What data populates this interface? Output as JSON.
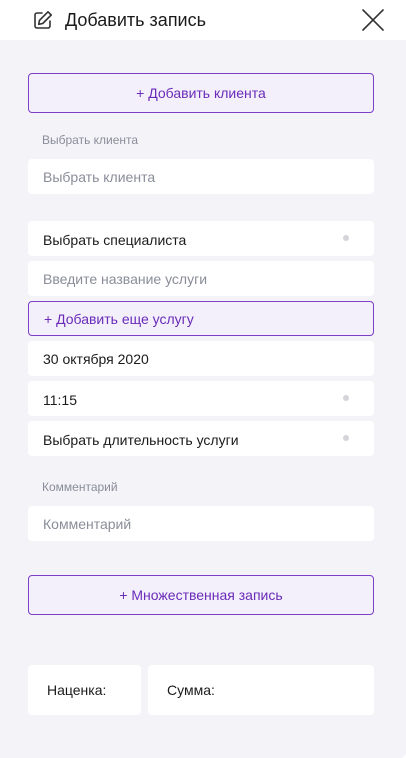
{
  "header": {
    "title": "Добавить запись"
  },
  "form": {
    "add_client_button": "+ Добавить клиента",
    "client_label": "Выбрать клиента",
    "client_placeholder": "Выбрать клиента",
    "specialist_value": "Выбрать специалиста",
    "service_placeholder": "Введите название услуги",
    "add_service_button": "+ Добавить еще услугу",
    "date_value": "30 октября 2020",
    "time_value": "11:15",
    "duration_value": "Выбрать длительность услуги",
    "comment_label": "Комментарий",
    "comment_placeholder": "Комментарий",
    "multiple_button": "+ Множественная запись"
  },
  "footer": {
    "markup_label": "Наценка:",
    "sum_label": "Сумма:"
  },
  "colors": {
    "accent": "#7b3fc8",
    "panel_bg": "#f3f3f8"
  },
  "icons": {
    "edit": "edit-icon",
    "close": "close-icon"
  }
}
